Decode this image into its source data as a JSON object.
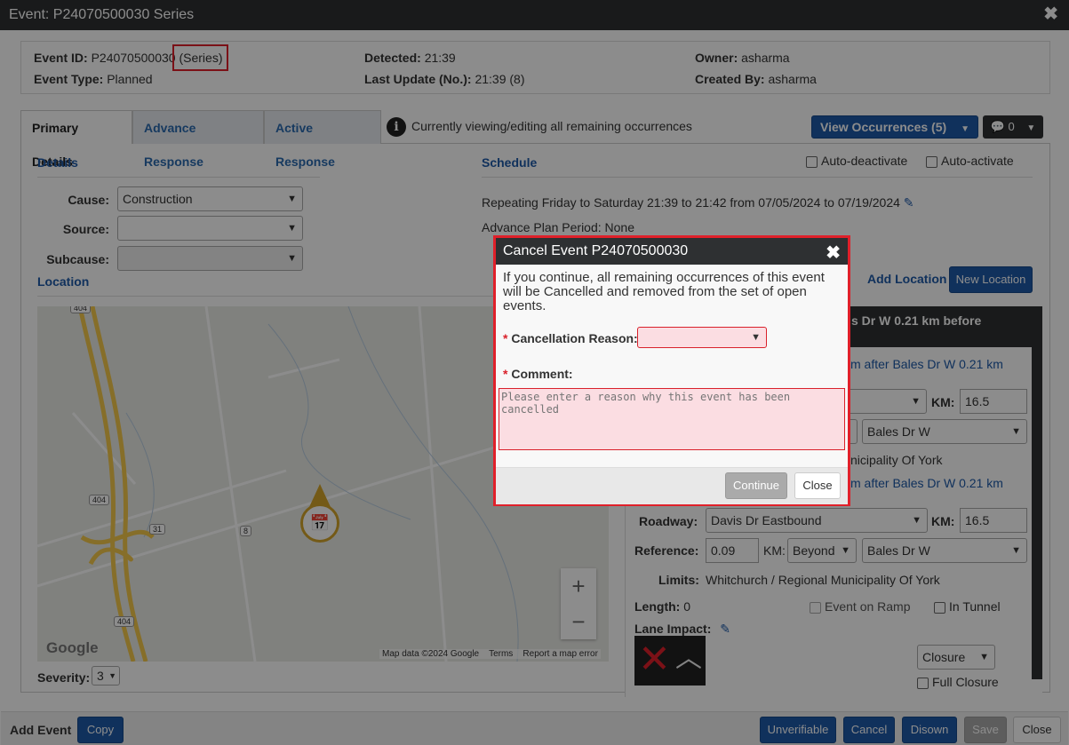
{
  "window": {
    "title": "Event: P24070500030 Series",
    "close": "✖"
  },
  "header": {
    "event_id_label": "Event ID:",
    "event_id": "P24070500030",
    "series": "(Series)",
    "event_type_label": "Event Type:",
    "event_type": "Planned",
    "detected_label": "Detected:",
    "detected": "21:39",
    "last_update_label": "Last Update (No.):",
    "last_update": "21:39 (8)",
    "owner_label": "Owner:",
    "owner": "asharma",
    "created_by_label": "Created By:",
    "created_by": "asharma"
  },
  "tabs": [
    {
      "label": "Primary Details"
    },
    {
      "label": "Advance Response"
    },
    {
      "label": "Active Response"
    }
  ],
  "info_text": "Currently viewing/editing all remaining occurrences",
  "view_occurrences": "View Occurrences (5)",
  "comments_count": "0",
  "details": {
    "title": "Details",
    "cause_label": "Cause:",
    "cause": "Construction",
    "source_label": "Source:",
    "source": "",
    "subcause_label": "Subcause:",
    "subcause": ""
  },
  "location_title": "Location",
  "schedule": {
    "title": "Schedule",
    "auto_deactivate": "Auto-deactivate",
    "auto_activate": "Auto-activate",
    "repeating": "Repeating Friday to Saturday 21:39 to 21:42 from 07/05/2024 to 07/19/2024",
    "advance": "Advance Plan Period: None"
  },
  "add_location": "Add Location",
  "new_location": "New Location",
  "loc_card": {
    "heading": "s Dr W 0.21 km before",
    "line1": "m after Bales Dr W 0.21 km",
    "km_label": "KM:",
    "km1": "16.5",
    "ref_road1": "Bales Dr W",
    "limits1": "nicipality Of York",
    "line2": "m after Bales Dr W 0.21 km",
    "roadway_label": "Roadway:",
    "roadway": "Davis Dr Eastbound",
    "km2": "16.5",
    "reference_label": "Reference:",
    "reference": "0.09",
    "km_mid_label": "KM:",
    "beyond": "Beyond",
    "ref_road2": "Bales Dr W",
    "limits_label": "Limits:",
    "limits": "Whitchurch / Regional Municipality Of York",
    "length_label": "Length:",
    "length": "0",
    "event_on_ramp": "Event on Ramp",
    "in_tunnel": "In Tunnel",
    "lane_impact_label": "Lane Impact:",
    "closure": "Closure",
    "full_closure": "Full Closure"
  },
  "map": {
    "shields": [
      "404",
      "404",
      "404",
      "31",
      "8"
    ],
    "attribution": "Map data ©2024 Google",
    "terms": "Terms",
    "report": "Report a map error",
    "google": "Google",
    "zoom_in": "+",
    "zoom_out": "−"
  },
  "severity_label": "Severity:",
  "severity": "3",
  "footer": {
    "add_event": "Add Event",
    "copy": "Copy",
    "unverifiable": "Unverifiable",
    "cancel": "Cancel",
    "disown": "Disown",
    "save": "Save",
    "close": "Close"
  },
  "dialog": {
    "title": "Cancel Event P24070500030",
    "close": "✖",
    "message": "If you continue, all remaining occurrences of this event will be Cancelled and removed from the set of open events.",
    "required_mark": "*",
    "reason_label": "Cancellation Reason:",
    "comment_label": "Comment:",
    "comment_placeholder": "Please enter a reason why this event has been cancelled",
    "continue": "Continue",
    "close_btn": "Close"
  }
}
